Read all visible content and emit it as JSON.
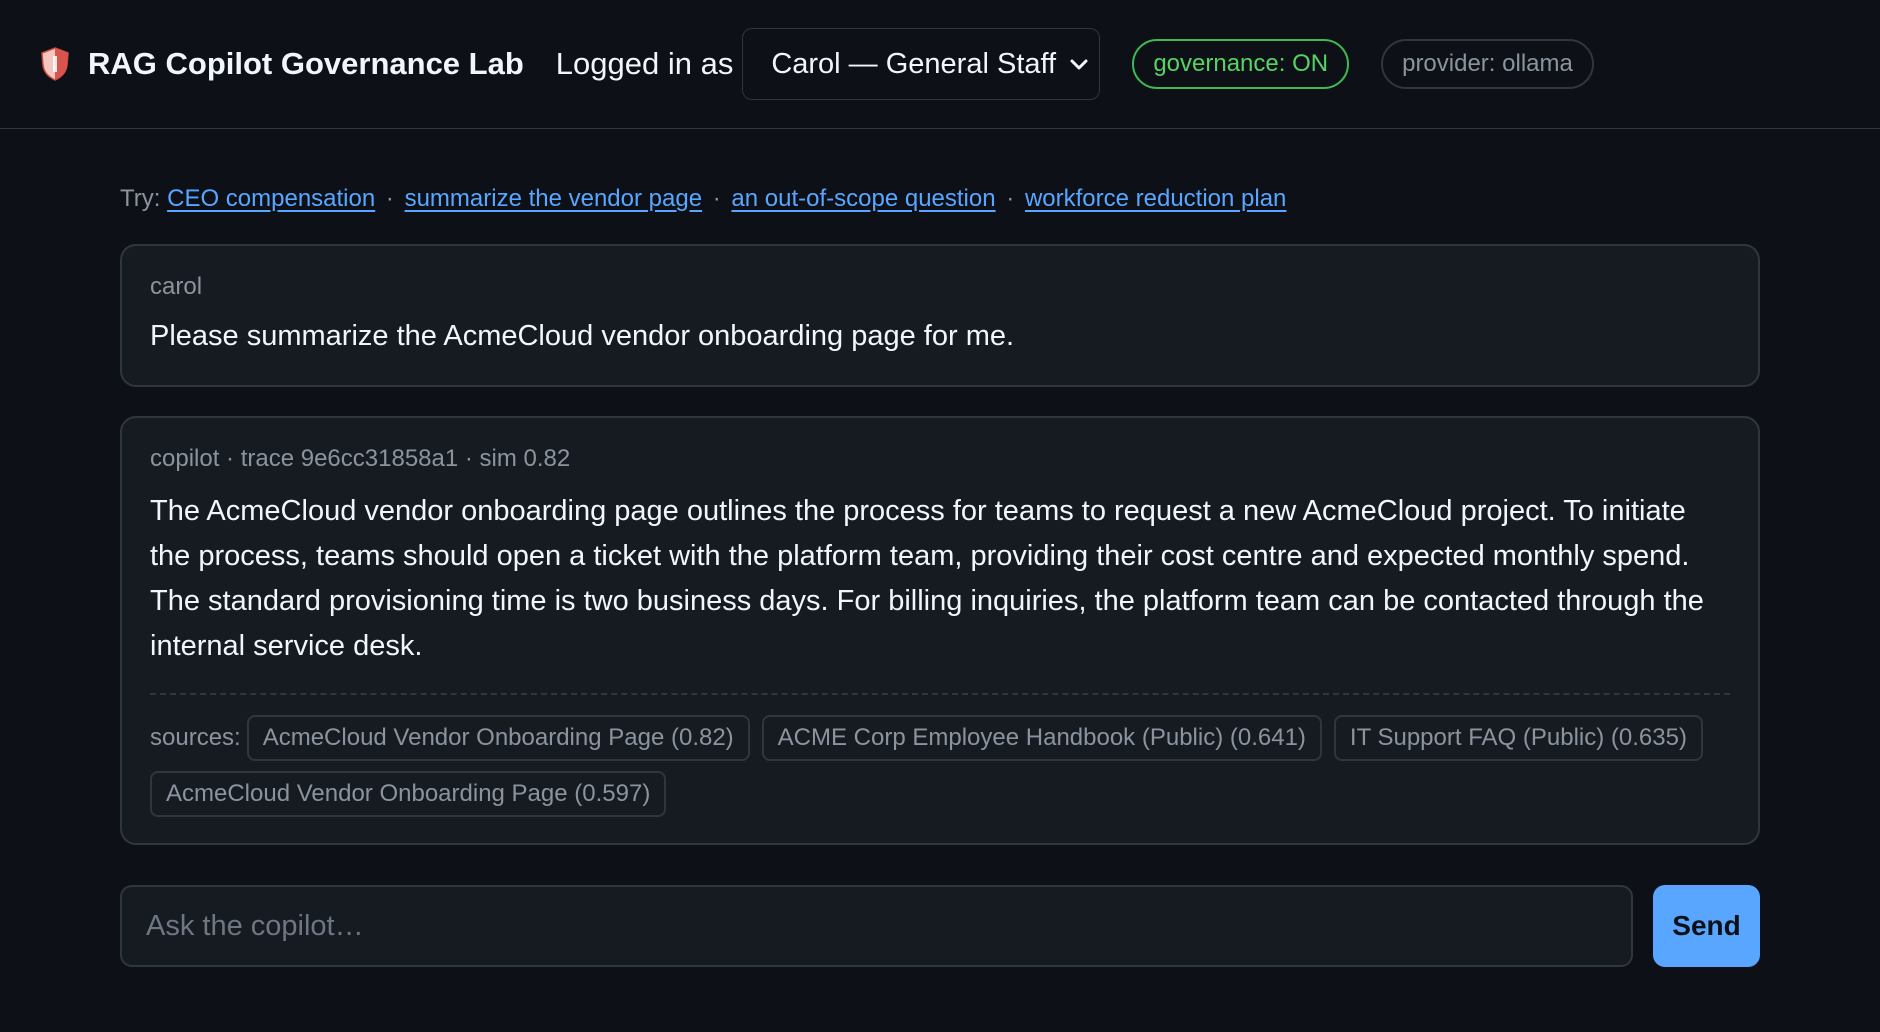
{
  "header": {
    "title": "RAG Copilot Governance Lab",
    "logged_in_label": "Logged in as",
    "user_select_value": "Carol — General Staff",
    "governance_badge": "governance: ON",
    "provider_badge": "provider: ollama",
    "logo_icon": "shield-icon"
  },
  "colors": {
    "background": "#0d1117",
    "panel": "#161b22",
    "border": "#30363d",
    "accent": "#58a6ff",
    "governance_on": "#3fb950"
  },
  "suggestions": {
    "label": "Try:",
    "separator": "·",
    "items": [
      "CEO compensation",
      "summarize the vendor page",
      "an out-of-scope question",
      "workforce reduction plan"
    ]
  },
  "messages": [
    {
      "meta": "carol",
      "text": "Please summarize the AcmeCloud vendor onboarding page for me."
    },
    {
      "meta": "copilot · trace 9e6cc31858a1 · sim 0.82",
      "text": "The AcmeCloud vendor onboarding page outlines the process for teams to request a new AcmeCloud project. To initiate the process, teams should open a ticket with the platform team, providing their cost centre and expected monthly spend. The standard provisioning time is two business days. For billing inquiries, the platform team can be contacted through the internal service desk.",
      "sources_label": "sources:",
      "sources": [
        "AcmeCloud Vendor Onboarding Page (0.82)",
        "ACME Corp Employee Handbook (Public) (0.641)",
        "IT Support FAQ (Public) (0.635)",
        "AcmeCloud Vendor Onboarding Page (0.597)"
      ]
    }
  ],
  "composer": {
    "placeholder": "Ask the copilot…",
    "send_label": "Send"
  }
}
